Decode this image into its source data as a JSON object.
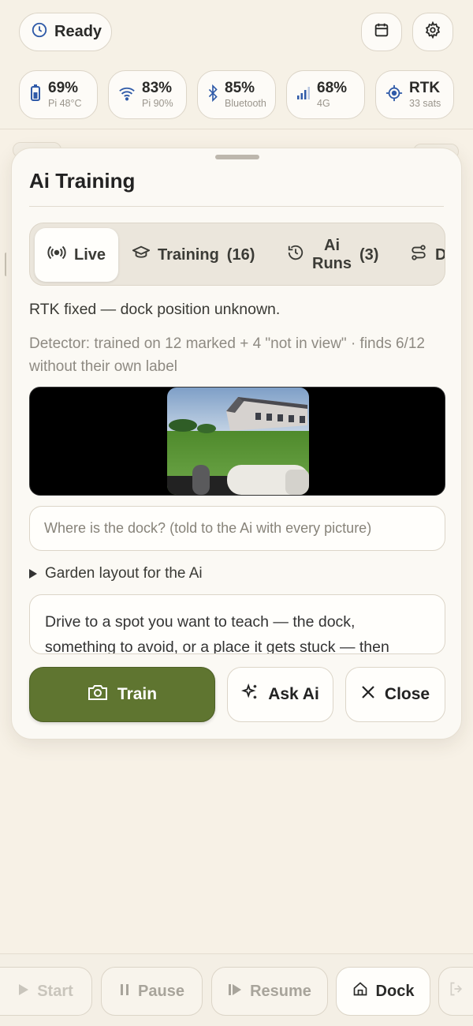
{
  "header": {
    "status_label": "Ready",
    "stats": [
      {
        "value": "69%",
        "sub": "Pi 48°C",
        "icon": "battery-icon"
      },
      {
        "value": "83%",
        "sub": "Pi 90%",
        "icon": "wifi-icon"
      },
      {
        "value": "85%",
        "sub": "Bluetooth",
        "icon": "bluetooth-icon"
      },
      {
        "value": "68%",
        "sub": "4G",
        "icon": "cellular-signal-icon"
      },
      {
        "value": "RTK",
        "sub": "33 sats",
        "icon": "gps-target-icon"
      }
    ]
  },
  "sheet": {
    "title": "Ai Training",
    "tabs": [
      {
        "label": "Live",
        "count": "",
        "icon": "broadcast-icon",
        "active": true
      },
      {
        "label": "Training",
        "count": "(16)",
        "icon": "graduation-cap-icon"
      },
      {
        "label_line1": "Ai",
        "label_line2": "Runs",
        "count": "(3)",
        "icon": "history-icon"
      },
      {
        "label": "Driv",
        "icon": "route-icon"
      }
    ],
    "status_text": "RTK fixed — dock position unknown.",
    "detector_text": "Detector: trained on 12 marked + 4 \"not in view\" · finds 6/12 without their own label",
    "dock_prompt_placeholder": "Where is the dock? (told to the Ai with every picture)",
    "garden_layout_label": "Garden layout for the Ai",
    "instructions_text": "Drive to a spot you want to teach — the dock, something to avoid, or a place it gets stuck — then",
    "buttons": {
      "train": "Train",
      "ask": "Ask Ai",
      "close": "Close"
    }
  },
  "footer": {
    "start": "Start",
    "pause": "Pause",
    "resume": "Resume",
    "dock": "Dock"
  },
  "colors": {
    "accent_green": "#5f7530",
    "icon_blue": "#2f5aa8",
    "background": "#f7f1e6"
  }
}
